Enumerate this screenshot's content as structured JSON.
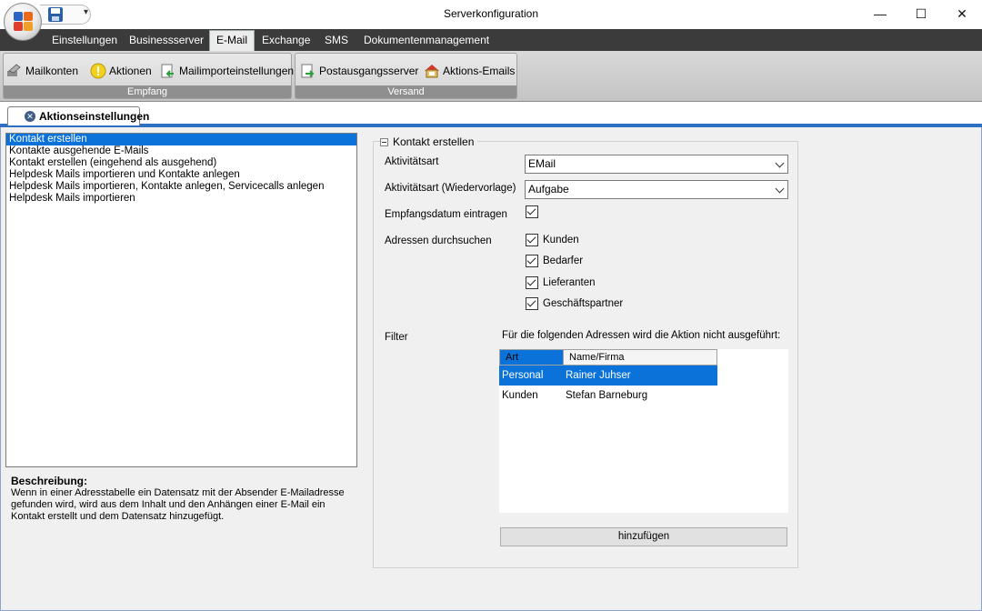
{
  "window": {
    "title": "Serverkonfiguration",
    "controls": {
      "minimize": "—",
      "maximize": "☐",
      "close": "✕"
    },
    "qat_more": "▾"
  },
  "ribbon": {
    "tabs": [
      "Einstellungen",
      "Businessserver",
      "E-Mail",
      "Exchange",
      "SMS",
      "Dokumentenmanagement"
    ],
    "active_tab": "E-Mail",
    "groups": [
      {
        "label": "Empfang",
        "buttons": [
          "Mailkonten",
          "Aktionen",
          "Mailimporteinstellungen"
        ]
      },
      {
        "label": "Versand",
        "buttons": [
          "Postausgangsserver",
          "Aktions-Emails"
        ]
      }
    ]
  },
  "document_tab": {
    "label": "Aktionseinstellungen",
    "close": "✕"
  },
  "actions": {
    "items": [
      "Kontakt erstellen",
      "Kontakte ausgehende E-Mails",
      "Kontakt erstellen (eingehend als ausgehend)",
      "Helpdesk Mails importieren und Kontakte anlegen",
      "Helpdesk Mails importieren, Kontakte anlegen, Servicecalls anlegen",
      "Helpdesk Mails importieren"
    ],
    "selected_index": 0
  },
  "description": {
    "title": "Beschreibung:",
    "text": "Wenn in einer Adresstabelle ein Datensatz mit der Absender E-Mailadresse gefunden wird, wird aus dem Inhalt und den Anhängen einer E-Mail ein Kontakt erstellt und dem Datensatz hinzugefügt."
  },
  "settings": {
    "group_title": "Kontakt erstellen",
    "aktivitaetsart_label": "Aktivitätsart",
    "aktivitaetsart_value": "EMail",
    "wiedervorlage_label": "Aktivitätsart (Wiedervorlage)",
    "wiedervorlage_value": "Aufgabe",
    "empfangsdatum_label": "Empfangsdatum eintragen",
    "empfangsdatum_checked": true,
    "adressen_label": "Adressen durchsuchen",
    "address_types": [
      {
        "label": "Kunden",
        "checked": true
      },
      {
        "label": "Bedarfer",
        "checked": true
      },
      {
        "label": "Lieferanten",
        "checked": true
      },
      {
        "label": "Geschäftspartner",
        "checked": true
      }
    ],
    "filter_label": "Filter",
    "filter_note": "Für die folgenden Adressen wird die Aktion nicht ausgeführt:",
    "filter_columns": [
      "Art",
      "Name/Firma"
    ],
    "filter_rows": [
      {
        "art": "Personal",
        "name": "Rainer Juhser",
        "selected": true
      },
      {
        "art": "Kunden",
        "name": "Stefan Barneburg",
        "selected": false
      }
    ],
    "add_button": "hinzufügen"
  }
}
